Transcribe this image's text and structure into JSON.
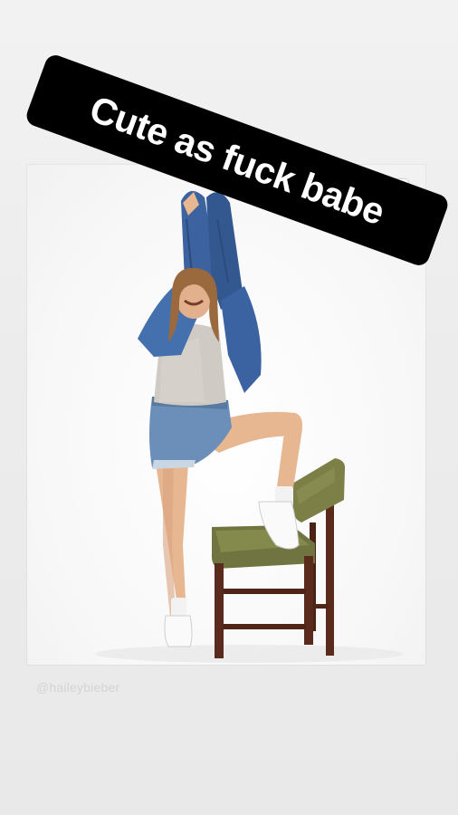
{
  "story": {
    "caption_sticker": "Cute as fuck babe",
    "post_author_tag": "@haileybieber",
    "background_color": "#ebebeb",
    "caption_background": "#000000",
    "caption_text_color": "#ffffff"
  },
  "post": {
    "photo_subject": "woman-denim-jacket-chair",
    "multi_icon": "square-overlay-icon"
  }
}
